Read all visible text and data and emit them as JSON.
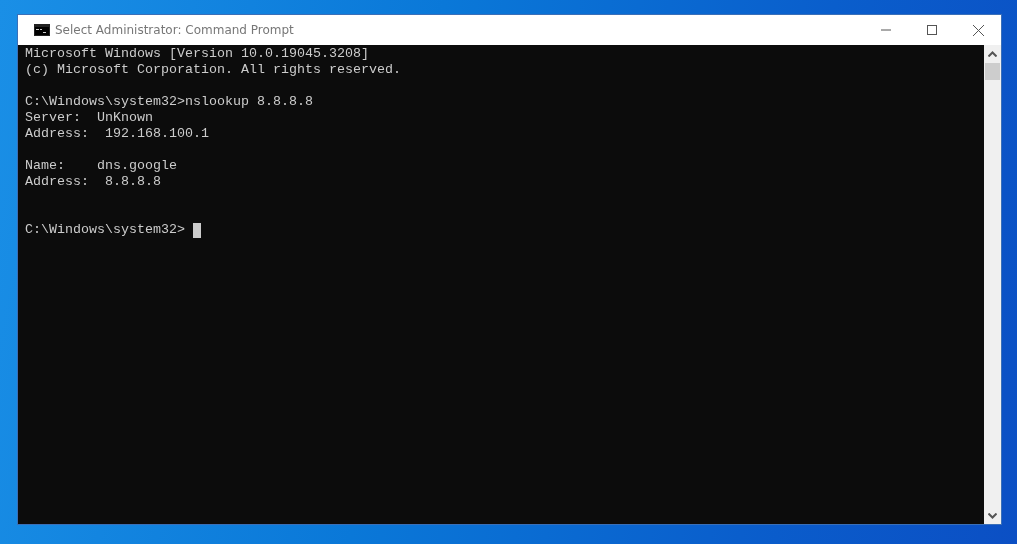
{
  "window": {
    "title": "Select Administrator: Command Prompt"
  },
  "console": {
    "lines": [
      {
        "kind": "text",
        "text": "Microsoft Windows [Version 10.0.19045.3208]"
      },
      {
        "kind": "text",
        "text": "(c) Microsoft Corporation. All rights reserved."
      },
      {
        "kind": "blank"
      },
      {
        "kind": "text",
        "text": "C:\\Windows\\system32>nslookup 8.8.8.8"
      },
      {
        "kind": "text",
        "text": "Server:  UnKnown"
      },
      {
        "kind": "text",
        "text": "Address:  192.168.100.1"
      },
      {
        "kind": "blank"
      },
      {
        "kind": "text",
        "text": "Name:    dns.google"
      },
      {
        "kind": "text",
        "text": "Address:  8.8.8.8"
      },
      {
        "kind": "blank"
      },
      {
        "kind": "blank"
      },
      {
        "kind": "prompt",
        "text": "C:\\Windows\\system32>",
        "cursor": true
      }
    ]
  }
}
